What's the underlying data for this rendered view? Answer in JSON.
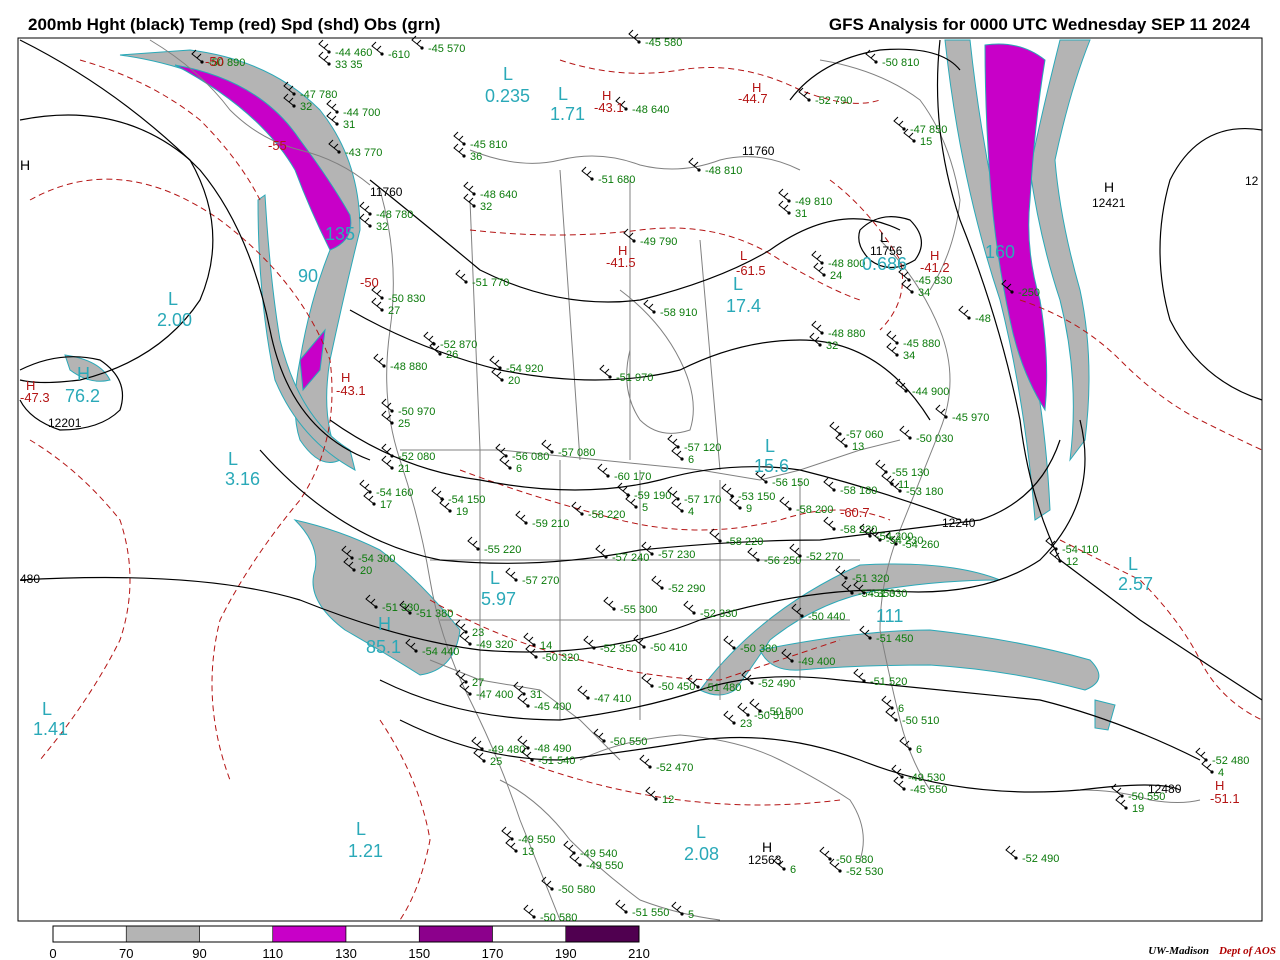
{
  "header": {
    "title_left": "200mb Hght (black) Temp (red) Spd (shd) Obs (grn)",
    "title_right": "GFS Analysis for 0000 UTC Wednesday  SEP 11 2024"
  },
  "credit": {
    "org": "UW-Madison",
    "dept": "Dept of AOS"
  },
  "colors": {
    "height_contour": "#000000",
    "temp_contour": "#b41414",
    "obs": "#0a7a0a",
    "speed_70_90": "#b4b4b4",
    "speed_110_130": "#c800c8",
    "speed_150_170": "#8c008c",
    "speed_190_210": "#500050",
    "extrema_cyan": "#2aa9b8",
    "country_border": "#808080"
  },
  "colorbar": {
    "ticks": [
      "0",
      "70",
      "90",
      "110",
      "130",
      "150",
      "170",
      "190",
      "210"
    ],
    "segment_fills": [
      "#ffffff",
      "#b4b4b4",
      "#ffffff",
      "#c800c8",
      "#ffffff",
      "#8c008c",
      "#ffffff",
      "#500050",
      "#ffffff"
    ]
  },
  "height_labels": [
    "11760",
    "11760",
    "12421",
    "12201",
    "480",
    "12240",
    "12480",
    "12563",
    "12",
    "11756"
  ],
  "extrema": [
    {
      "kind": "L",
      "value": "0.235"
    },
    {
      "kind": "L",
      "value": "1.71"
    },
    {
      "kind": "L",
      "value": "2.00"
    },
    {
      "kind": "H",
      "value": "76.2"
    },
    {
      "kind": "L",
      "value": "3.16"
    },
    {
      "kind": "L",
      "value": "17.4"
    },
    {
      "kind": "L",
      "value": "15.6"
    },
    {
      "kind": "L",
      "value": "5.97"
    },
    {
      "kind": "H",
      "value": "85.1"
    },
    {
      "kind": "L",
      "value": "1.41"
    },
    {
      "kind": "L",
      "value": "1.21"
    },
    {
      "kind": "L",
      "value": "2.08"
    },
    {
      "kind": "L",
      "value": "2.57"
    },
    {
      "kind": "L",
      "value": "111"
    },
    {
      "kind": "",
      "value": "135"
    },
    {
      "kind": "",
      "value": "90"
    },
    {
      "kind": "",
      "value": "160"
    },
    {
      "kind": "",
      "value": "0.686"
    }
  ],
  "temp_extrema": [
    {
      "kind": "H",
      "value": "-43.1"
    },
    {
      "kind": "H",
      "value": "-44.7"
    },
    {
      "kind": "H",
      "value": "-41.5"
    },
    {
      "kind": "L",
      "value": "-61.5"
    },
    {
      "kind": "H",
      "value": "-41.2"
    },
    {
      "kind": "H",
      "value": "-47.3"
    },
    {
      "kind": "H",
      "value": "-43.1"
    },
    {
      "kind": "H",
      "value": "-51.1"
    },
    {
      "kind": "",
      "value": "-60.7"
    },
    {
      "kind": "",
      "value": "-50"
    },
    {
      "kind": "",
      "value": "-55"
    },
    {
      "kind": "",
      "value": "-50"
    }
  ],
  "observations": [
    [
      "-45",
      "570"
    ],
    [
      "-45",
      "580"
    ],
    [
      "-50",
      "810"
    ],
    [
      "-44",
      "460"
    ],
    [
      "33",
      "35"
    ],
    [
      "-610",
      ""
    ],
    [
      "-50",
      "890"
    ],
    [
      "-47",
      "780"
    ],
    [
      "32",
      ""
    ],
    [
      "-44",
      "700"
    ],
    [
      "31",
      ""
    ],
    [
      "-48",
      "640"
    ],
    [
      "-52",
      "790"
    ],
    [
      "-47",
      "850"
    ],
    [
      "15",
      ""
    ],
    [
      "-45",
      "810"
    ],
    [
      "36",
      ""
    ],
    [
      "-51",
      "680"
    ],
    [
      "-48",
      "640"
    ],
    [
      "32",
      ""
    ],
    [
      "-48",
      "810"
    ],
    [
      "-49",
      "810"
    ],
    [
      "31",
      ""
    ],
    [
      "-43",
      "770"
    ],
    [
      "-48",
      "780"
    ],
    [
      "32",
      ""
    ],
    [
      "-49",
      "790"
    ],
    [
      "-51",
      "770"
    ],
    [
      "-50",
      "830"
    ],
    [
      "27",
      ""
    ],
    [
      "-48",
      "800"
    ],
    [
      "24",
      ""
    ],
    [
      "-45",
      "830"
    ],
    [
      "34",
      ""
    ],
    [
      "-48",
      ""
    ],
    [
      "-250",
      ""
    ],
    [
      "-52",
      "870"
    ],
    [
      "26",
      ""
    ],
    [
      "-58",
      "910"
    ],
    [
      "-48",
      "880"
    ],
    [
      "32",
      ""
    ],
    [
      "-45",
      "880"
    ],
    [
      "34",
      ""
    ],
    [
      "-48",
      "880"
    ],
    [
      "-54",
      "920"
    ],
    [
      "20",
      ""
    ],
    [
      "-51",
      "970"
    ],
    [
      "-44",
      "900"
    ],
    [
      "-50",
      "970"
    ],
    [
      "25",
      ""
    ],
    [
      "-45",
      "970"
    ],
    [
      "-57",
      "060"
    ],
    [
      "13",
      ""
    ],
    [
      "-50",
      "030"
    ],
    [
      "-52",
      "080"
    ],
    [
      "21",
      ""
    ],
    [
      "-56",
      "080"
    ],
    [
      "6",
      ""
    ],
    [
      "-57",
      "080"
    ],
    [
      "-57",
      "120"
    ],
    [
      "6",
      ""
    ],
    [
      "-55",
      "130"
    ],
    [
      "11",
      ""
    ],
    [
      "-54",
      "160"
    ],
    [
      "17",
      ""
    ],
    [
      "-54",
      "150"
    ],
    [
      "19",
      ""
    ],
    [
      "-60",
      "170"
    ],
    [
      "-59",
      "190"
    ],
    [
      "5",
      ""
    ],
    [
      "-57",
      "170"
    ],
    [
      "4",
      ""
    ],
    [
      "-53",
      "150"
    ],
    [
      "9",
      ""
    ],
    [
      "-56",
      "150"
    ],
    [
      "-58",
      "180"
    ],
    [
      "-53",
      "180"
    ],
    [
      "-59",
      "210"
    ],
    [
      "-58",
      "220"
    ],
    [
      "-58",
      "200"
    ],
    [
      "-58",
      "230"
    ],
    [
      "-54",
      "260"
    ],
    [
      "-54",
      "230"
    ],
    [
      "-54",
      "200"
    ],
    [
      "-55",
      "220"
    ],
    [
      "-58",
      "220"
    ],
    [
      "-56",
      "250"
    ],
    [
      "-52",
      "270"
    ],
    [
      "-57",
      "240"
    ],
    [
      "-57",
      "230"
    ],
    [
      "-54",
      "300"
    ],
    [
      "20",
      ""
    ],
    [
      "-57",
      "270"
    ],
    [
      "-52",
      "290"
    ],
    [
      "-51",
      "320"
    ],
    [
      "-54",
      "350"
    ],
    [
      "-54",
      "110"
    ],
    [
      "12",
      ""
    ],
    [
      "-55",
      "300"
    ],
    [
      "-52",
      "330"
    ],
    [
      "-51",
      "330"
    ],
    [
      "-51",
      "380"
    ],
    [
      "-54",
      "440"
    ],
    [
      "-51",
      "330"
    ],
    [
      "23",
      ""
    ],
    [
      "-49",
      "320"
    ],
    [
      "14",
      ""
    ],
    [
      "-50",
      "320"
    ],
    [
      "-52",
      "350"
    ],
    [
      "-50",
      "410"
    ],
    [
      "-50",
      "380"
    ],
    [
      "-50",
      "440"
    ],
    [
      "-51",
      "450"
    ],
    [
      "-49",
      "400"
    ],
    [
      "27",
      ""
    ],
    [
      "-47",
      "400"
    ],
    [
      "31",
      ""
    ],
    [
      "-45",
      "400"
    ],
    [
      "-47",
      "410"
    ],
    [
      "-50",
      "450"
    ],
    [
      "-51",
      "480"
    ],
    [
      "-52",
      "490"
    ],
    [
      "-51",
      "520"
    ],
    [
      "6",
      ""
    ],
    [
      "-50",
      "510"
    ],
    [
      "-50",
      "510"
    ],
    [
      "-50",
      "500"
    ],
    [
      "23",
      ""
    ],
    [
      "-49",
      "480"
    ],
    [
      "25",
      ""
    ],
    [
      "-48",
      "490"
    ],
    [
      "-51",
      "540"
    ],
    [
      "-50",
      "550"
    ],
    [
      "6",
      ""
    ],
    [
      "-49",
      "530"
    ],
    [
      "-45",
      "550"
    ],
    [
      "-52",
      "470"
    ],
    [
      "12",
      ""
    ],
    [
      "-52",
      "480"
    ],
    [
      "4",
      ""
    ],
    [
      "-50",
      "550"
    ],
    [
      "19",
      ""
    ],
    [
      "-49",
      "550"
    ],
    [
      "13",
      ""
    ],
    [
      "-49",
      "540"
    ],
    [
      "-49",
      "550"
    ],
    [
      "-50",
      "580"
    ],
    [
      "-50",
      "580"
    ],
    [
      "-51",
      "550"
    ],
    [
      "5",
      ""
    ],
    [
      "-50",
      "580"
    ],
    [
      "-52",
      "530"
    ],
    [
      "6",
      ""
    ],
    [
      "-52",
      "490"
    ]
  ]
}
